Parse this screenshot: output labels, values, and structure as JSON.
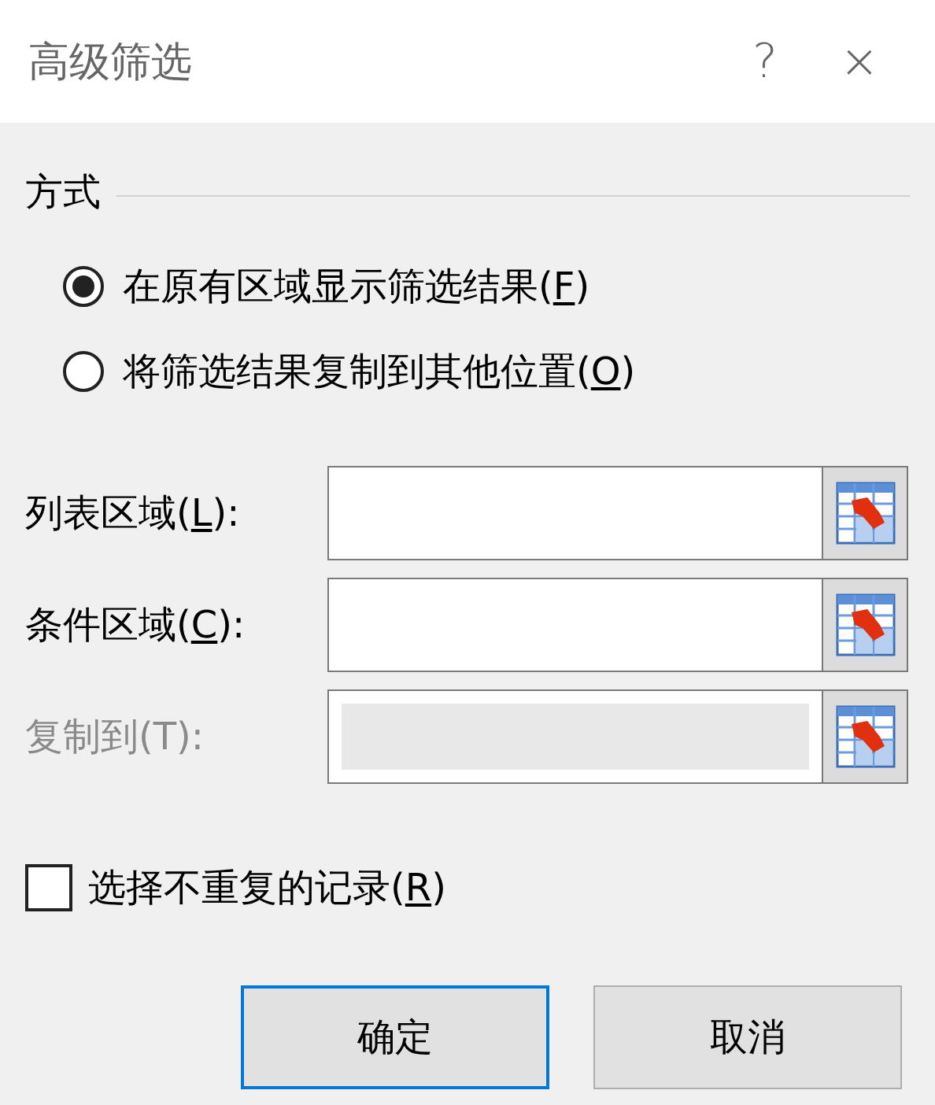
{
  "window": {
    "title": "高级筛选",
    "help": "?",
    "close": "×"
  },
  "method": {
    "title": "方式",
    "options": [
      {
        "selected": true,
        "label": [
          {
            "text": "在原有区域显示筛选结果("
          },
          {
            "text": "F",
            "underlined": true
          },
          {
            "text": ")"
          }
        ]
      },
      {
        "selected": false,
        "label": [
          {
            "text": "将筛选结果复制到其他位置("
          },
          {
            "text": "O",
            "underlined": true
          },
          {
            "text": ")"
          }
        ]
      }
    ]
  },
  "fields": [
    {
      "disabled": false,
      "label": [
        {
          "text": "列表区域("
        },
        {
          "text": "L",
          "underlined": true
        },
        {
          "text": "):"
        }
      ]
    },
    {
      "disabled": false,
      "label": [
        {
          "text": "条件区域("
        },
        {
          "text": "C",
          "underlined": true
        },
        {
          "text": "):"
        }
      ]
    },
    {
      "disabled": true,
      "label": [
        {
          "text": "复制到(T):"
        }
      ]
    }
  ],
  "unique": {
    "checked": false,
    "label": [
      {
        "text": "选择不重复的记录("
      },
      {
        "text": "R",
        "underlined": true
      },
      {
        "text": ")"
      }
    ]
  },
  "buttons": [
    {
      "label": "确定",
      "default": true
    },
    {
      "label": "取消",
      "default": false
    }
  ]
}
